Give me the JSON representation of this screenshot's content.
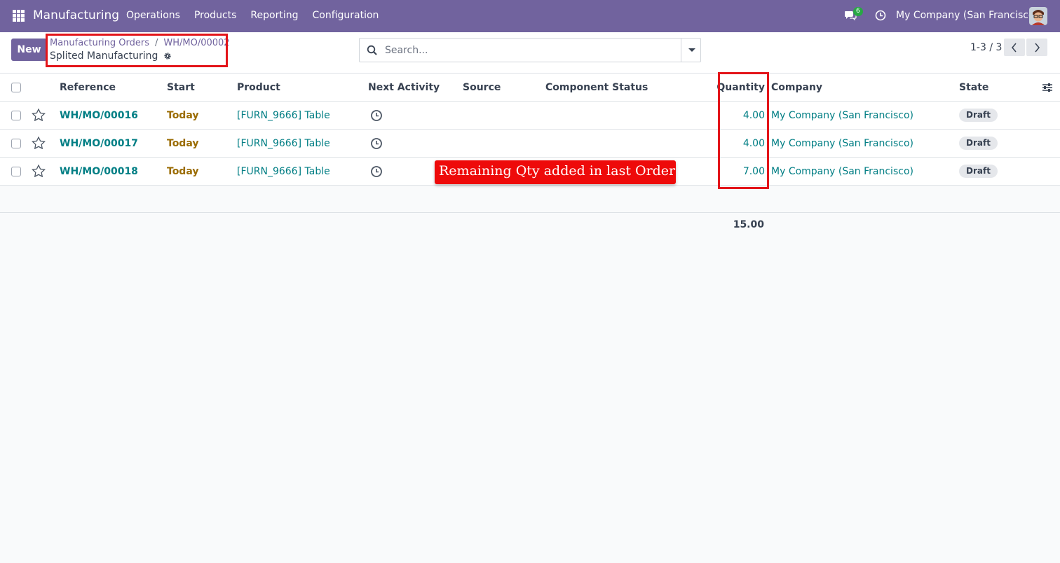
{
  "navbar": {
    "app_name": "Manufacturing",
    "menu": [
      "Operations",
      "Products",
      "Reporting",
      "Configuration"
    ],
    "message_count": "6",
    "company": "My Company (San Francisco)",
    "icons": [
      "apps-grid-icon",
      "chat-icon",
      "activity-clock-icon",
      "user-avatar"
    ],
    "accent_color": "#71639e"
  },
  "control_panel": {
    "new_label": "New",
    "breadcrumb": [
      "Manufacturing Orders",
      "WH/MO/00002"
    ],
    "breadcrumb_separator": "/",
    "page_subtitle": "Splited Manufacturing",
    "search_placeholder": "Search...",
    "pager": "1-3 / 3"
  },
  "table": {
    "headers": {
      "reference": "Reference",
      "start": "Start",
      "product": "Product",
      "next_activity": "Next Activity",
      "source": "Source",
      "component_status": "Component Status",
      "quantity": "Quantity",
      "company": "Company",
      "state": "State"
    },
    "rows": [
      {
        "reference": "WH/MO/00016",
        "start": "Today",
        "product": "[FURN_9666] Table",
        "source": "",
        "component_status": "",
        "quantity": "4.00",
        "company": "My Company (San Francisco)",
        "state": "Draft"
      },
      {
        "reference": "WH/MO/00017",
        "start": "Today",
        "product": "[FURN_9666] Table",
        "source": "",
        "component_status": "",
        "quantity": "4.00",
        "company": "My Company (San Francisco)",
        "state": "Draft"
      },
      {
        "reference": "WH/MO/00018",
        "start": "Today",
        "product": "[FURN_9666] Table",
        "source": "",
        "component_status": "",
        "quantity": "7.00",
        "company": "My Company (San Francisco)",
        "state": "Draft"
      }
    ],
    "total_quantity": "15.00"
  },
  "annotation": {
    "text": "Remaining Qty added in last Order",
    "color": "#ee0a0a"
  }
}
